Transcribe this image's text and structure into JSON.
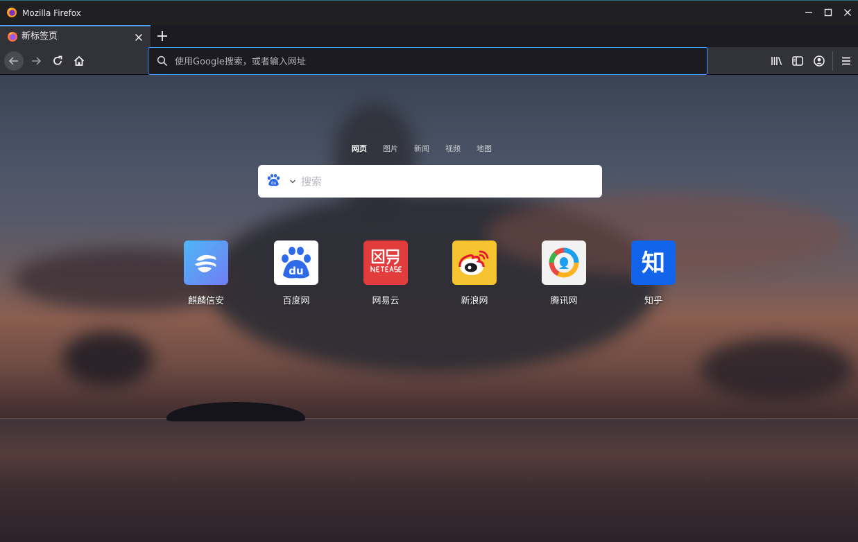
{
  "window": {
    "title": "Mozilla Firefox"
  },
  "tabs": [
    {
      "title": "新标签页"
    }
  ],
  "toolbar": {
    "url_placeholder": "使用Google搜索，或者输入网址"
  },
  "page": {
    "search_tabs": [
      "网页",
      "图片",
      "新闻",
      "视频",
      "地图"
    ],
    "search_placeholder": "搜索",
    "sites": [
      {
        "label": "麒麟信安",
        "icon": "qilin-xinan-icon",
        "color": "#6b83f6"
      },
      {
        "label": "百度网",
        "icon": "baidu-icon",
        "color": "#ffffff"
      },
      {
        "label": "网易云",
        "icon": "netease-icon",
        "color": "#e23c3c"
      },
      {
        "label": "新浪网",
        "icon": "weibo-icon",
        "color": "#f6c431"
      },
      {
        "label": "腾讯网",
        "icon": "tencent-icon",
        "color": "#f2f2f2"
      },
      {
        "label": "知乎",
        "icon": "zhihu-icon",
        "color": "#1264ea"
      }
    ]
  },
  "colors": {
    "accent": "#45a1ff",
    "titlebar": "#202023",
    "toolbar": "#323239"
  }
}
